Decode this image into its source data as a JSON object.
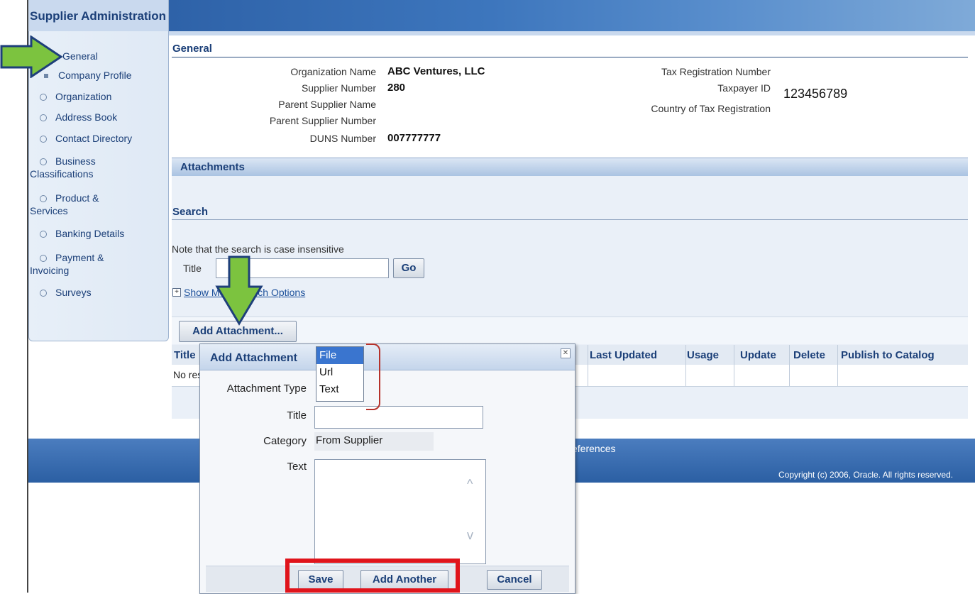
{
  "app": {
    "title": "Supplier Administration"
  },
  "sidebar": {
    "items": [
      {
        "label": "General"
      },
      {
        "label": "Company Profile"
      }
    ],
    "sub_items": [
      {
        "label": "Organization"
      },
      {
        "label": "Address Book"
      },
      {
        "label": "Contact Directory"
      },
      {
        "label_line1": "Business",
        "label_line2": "Classifications"
      },
      {
        "label_line1": "Product &",
        "label_line2": "Services"
      },
      {
        "label": "Banking Details"
      },
      {
        "label_line1": "Payment &",
        "label_line2": "Invoicing"
      },
      {
        "label": "Surveys"
      }
    ]
  },
  "general": {
    "section_title": "General",
    "org_name_label": "Organization Name",
    "org_name_value": "ABC Ventures, LLC",
    "supplier_number_label": "Supplier Number",
    "supplier_number_value": "280",
    "parent_name_label": "Parent Supplier Name",
    "parent_number_label": "Parent Supplier Number",
    "duns_label": "DUNS Number",
    "duns_value": "007777777",
    "tax_reg_label": "Tax Registration Number",
    "taxpayer_id_label": "Taxpayer ID",
    "taxpayer_id_value": "123456789",
    "country_tax_label": "Country of Tax Registration"
  },
  "attachments": {
    "header": "Attachments",
    "search_title": "Search",
    "note": "Note that the search is case insensitive",
    "title_label": "Title",
    "go_button": "Go",
    "more_options_link": "Show More Search Options",
    "add_button": "Add Attachment...",
    "columns": {
      "title": "Title",
      "last_updated": "Last Updated",
      "usage": "Usage",
      "update": "Update",
      "delete": "Delete",
      "publish": "Publish to Catalog"
    },
    "empty_row": "No results found."
  },
  "footer": {
    "preferences": "Preferences",
    "copyright": "Copyright (c) 2006, Oracle. All rights reserved."
  },
  "dialog": {
    "title": "Add Attachment",
    "attachment_type_label": "Attachment Type",
    "type_options": [
      "File",
      "Url",
      "Text"
    ],
    "selected_type": "File",
    "title_label": "Title",
    "category_label": "Category",
    "category_value": "From Supplier",
    "text_label": "Text",
    "save_button": "Save",
    "add_another_button": "Add Another",
    "cancel_button": "Cancel"
  },
  "colors": {
    "brand_blue": "#2f5f9e",
    "highlight_red": "#e0141b",
    "arrow_green": "#7cc33f"
  }
}
